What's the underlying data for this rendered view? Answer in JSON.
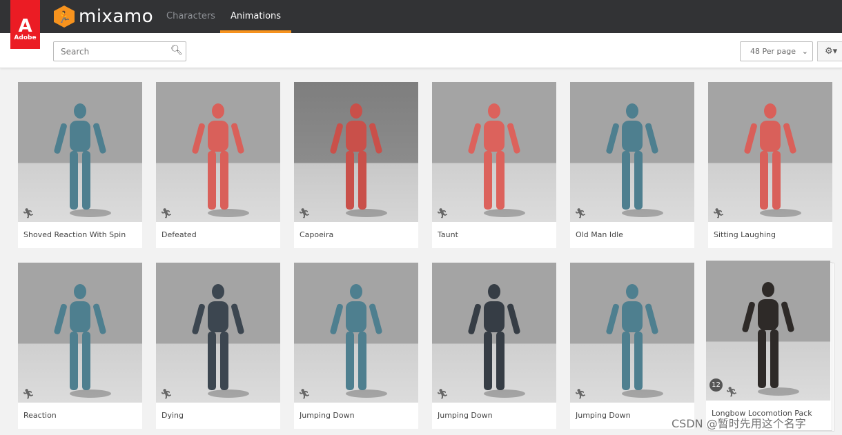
{
  "brand": {
    "adobe": "Adobe",
    "name": "mixamo"
  },
  "nav": {
    "tabs": [
      {
        "label": "Characters",
        "active": false
      },
      {
        "label": "Animations",
        "active": true
      }
    ]
  },
  "toolbar": {
    "search_placeholder": "Search",
    "per_page": "48 Per page"
  },
  "colors": {
    "accent": "#f7931e",
    "header": "#323335",
    "adobe_red": "#eb1c24"
  },
  "cards": [
    {
      "label": "Shoved Reaction With Spin",
      "color": "#4e7f8f"
    },
    {
      "label": "Defeated",
      "color": "#d9605a"
    },
    {
      "label": "Capoeira",
      "color": "#c9504a"
    },
    {
      "label": "Taunt",
      "color": "#dc625c"
    },
    {
      "label": "Old Man Idle",
      "color": "#4e7f8f"
    },
    {
      "label": "Sitting Laughing",
      "color": "#d9605a"
    },
    {
      "label": "Reaction",
      "color": "#4e7f8f"
    },
    {
      "label": "Dying",
      "color": "#3c4650"
    },
    {
      "label": "Jumping Down",
      "color": "#4e7f8f"
    },
    {
      "label": "Jumping Down",
      "color": "#363d45"
    },
    {
      "label": "Jumping Down",
      "color": "#4e7f8f"
    },
    {
      "label": "Longbow Locomotion Pack",
      "color": "#2e2a28",
      "pack_count": "12"
    }
  ],
  "watermark": "CSDN @暂时先用这个名字"
}
